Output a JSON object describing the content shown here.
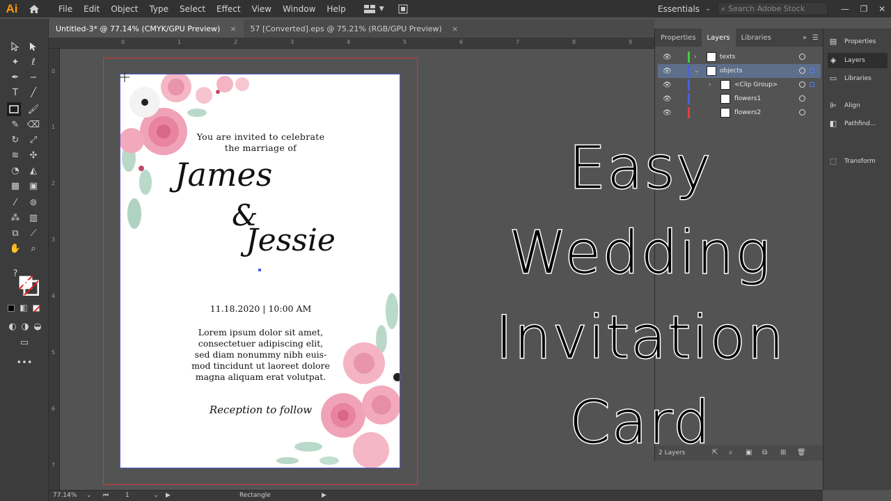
{
  "app": {
    "logo": "Ai",
    "menus": [
      "File",
      "Edit",
      "Object",
      "Type",
      "Select",
      "Effect",
      "View",
      "Window",
      "Help"
    ],
    "workspace": "Essentials",
    "search_placeholder": "Search Adobe Stock"
  },
  "tabs": [
    {
      "label": "Untitled-3* @ 77.14% (CMYK/GPU Preview)",
      "close": "×"
    },
    {
      "label": "57 [Converted].eps @ 75.21% (RGB/GPU Preview)",
      "close": "×"
    }
  ],
  "rulers": {
    "top": [
      "0",
      "1",
      "2",
      "3",
      "4",
      "5",
      "6",
      "7",
      "8",
      "9"
    ],
    "left": [
      "0",
      "1",
      "2",
      "3",
      "4",
      "5",
      "6",
      "7"
    ]
  },
  "card": {
    "invite_line1": "You are invited to celebrate",
    "invite_line2": "the marriage of",
    "name1": "James",
    "ampersand": "&",
    "name2": "Jessie",
    "datetime": "11.18.2020  |  10:00 AM",
    "body": [
      "Lorem ipsum dolor sit amet,",
      "consectetuer adipiscing elit,",
      "sed diam nonummy nibh euis-",
      "mod tincidunt ut laoreet dolore",
      "magna aliquam erat volutpat."
    ],
    "reception": "Reception to follow"
  },
  "layers_panel": {
    "tabs": [
      "Properties",
      "Layers",
      "Libraries"
    ],
    "active_tab": "Layers",
    "layers": [
      {
        "name": "texts",
        "color": "#3fcf3f",
        "expanded": false,
        "indent": 0
      },
      {
        "name": "objects",
        "color": "#4a5fe0",
        "expanded": true,
        "indent": 0,
        "selected": true
      },
      {
        "name": "<Clip Group>",
        "color": "#4a5fe0",
        "expanded": false,
        "indent": 1
      },
      {
        "name": "flowers1",
        "color": "#4a5fe0",
        "indent": 1
      },
      {
        "name": "flowers2",
        "color": "#e04040",
        "indent": 1
      }
    ],
    "footer": "2 Layers"
  },
  "side_panel": {
    "items": [
      "Properties",
      "Layers",
      "Libraries",
      "Align",
      "Pathfind...",
      "Transform"
    ],
    "active": "Layers"
  },
  "title": [
    "Easy",
    "Wedding",
    "Invitation Card"
  ],
  "status": {
    "zoom": "77.14%",
    "artboard": "1",
    "tool": "Rectangle"
  }
}
